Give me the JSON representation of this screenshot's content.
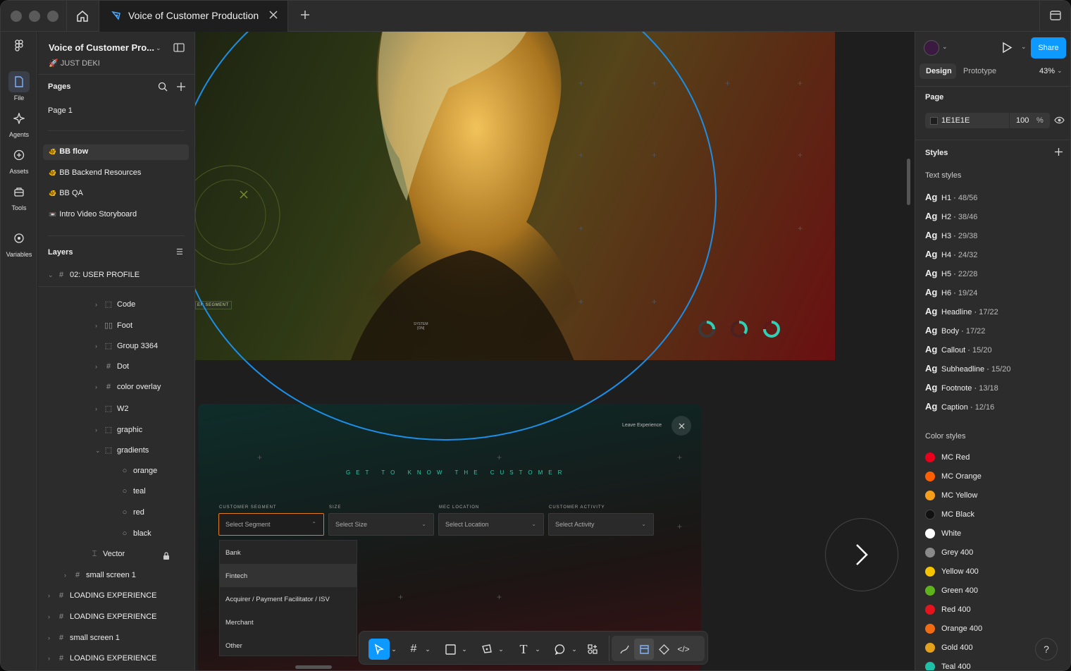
{
  "titlebar": {
    "tab_title": "Voice of Customer Production"
  },
  "rail": {
    "items": [
      {
        "label": "File",
        "icon": "file-icon"
      },
      {
        "label": "Agents",
        "icon": "agents-icon"
      },
      {
        "label": "Assets",
        "icon": "assets-icon"
      },
      {
        "label": "Tools",
        "icon": "tools-icon"
      },
      {
        "label": "Variables",
        "icon": "variables-icon"
      }
    ]
  },
  "left": {
    "file_name": "Voice of Customer Pro...",
    "team": "🚀 JUST DEKI",
    "pages_title": "Pages",
    "page1": "Page 1",
    "pages": [
      {
        "emoji": "🐠",
        "label": "BB flow"
      },
      {
        "emoji": "🐠",
        "label": "BB Backend Resources"
      },
      {
        "emoji": "🐠",
        "label": "BB QA"
      },
      {
        "emoji": "📼",
        "label": "Intro Video Storyboard"
      }
    ],
    "layers_title": "Layers",
    "layers": [
      {
        "label": "02: USER PROFILE",
        "icon": "#",
        "chev": "⌄"
      },
      {
        "label": "Code",
        "icon": "⬚",
        "chev": "›"
      },
      {
        "label": "Foot",
        "icon": "▯▯",
        "chev": "›"
      },
      {
        "label": "Group 3364",
        "icon": "⬚",
        "chev": "›"
      },
      {
        "label": "Dot",
        "icon": "#",
        "chev": "›"
      },
      {
        "label": "color overlay",
        "icon": "#",
        "chev": "›"
      },
      {
        "label": "W2",
        "icon": "⬚",
        "chev": "›"
      },
      {
        "label": "graphic",
        "icon": "⬚",
        "chev": "›"
      },
      {
        "label": "gradients",
        "icon": "⬚",
        "chev": "⌄"
      },
      {
        "label": "orange",
        "icon": "○",
        "chev": ""
      },
      {
        "label": "teal",
        "icon": "○",
        "chev": ""
      },
      {
        "label": "red",
        "icon": "○",
        "chev": ""
      },
      {
        "label": "black",
        "icon": "○",
        "chev": ""
      },
      {
        "label": "Vector",
        "icon": "⌶",
        "chev": ""
      },
      {
        "label": "small screen 1",
        "icon": "#",
        "chev": "›"
      },
      {
        "label": "LOADING EXPERIENCE",
        "icon": "#",
        "chev": "›"
      },
      {
        "label": "LOADING EXPERIENCE",
        "icon": "#",
        "chev": "›"
      },
      {
        "label": "small screen 1",
        "icon": "#",
        "chev": "›"
      },
      {
        "label": "LOADING EXPERIENCE",
        "icon": "#",
        "chev": "›"
      }
    ]
  },
  "canvas": {
    "frame_label_partial": "r",
    "segment_tag": "ER SEGMENT",
    "system_label": "SYSTEM",
    "system_value": "[ON]",
    "leave_experience": "Leave Experience",
    "heading": "GET TO KNOW THE CUSTOMER",
    "fields": [
      {
        "label": "CUSTOMER SEGMENT",
        "placeholder": "Select Segment"
      },
      {
        "label": "SIZE",
        "placeholder": "Select Size"
      },
      {
        "label": "MEC LOCATION",
        "placeholder": "Select Location"
      },
      {
        "label": "CUSTOMER ACTIVITY",
        "placeholder": "Select Activity"
      }
    ],
    "options": [
      "Bank",
      "Fintech",
      "Acquirer / Payment Facilitator / ISV",
      "Merchant",
      "Other"
    ]
  },
  "right": {
    "share": "Share",
    "tab_design": "Design",
    "tab_prototype": "Prototype",
    "zoom": "43%",
    "page_title": "Page",
    "page_color": "1E1E1E",
    "page_opacity": "100",
    "percent": "%",
    "styles_title": "Styles",
    "text_styles_title": "Text styles",
    "text_styles": [
      {
        "name": "H1",
        "size": "48/56"
      },
      {
        "name": "H2",
        "size": "38/46"
      },
      {
        "name": "H3",
        "size": "29/38"
      },
      {
        "name": "H4",
        "size": "24/32"
      },
      {
        "name": "H5",
        "size": "22/28"
      },
      {
        "name": "H6",
        "size": "19/24"
      },
      {
        "name": "Headline",
        "size": "17/22"
      },
      {
        "name": "Body",
        "size": "17/22"
      },
      {
        "name": "Callout",
        "size": "15/20"
      },
      {
        "name": "Subheadline",
        "size": "15/20"
      },
      {
        "name": "Footnote",
        "size": "13/18"
      },
      {
        "name": "Caption",
        "size": "12/16"
      }
    ],
    "color_styles_title": "Color styles",
    "color_styles": [
      {
        "name": "MC Red",
        "color": "#eb001b"
      },
      {
        "name": "MC Orange",
        "color": "#ff5f00"
      },
      {
        "name": "MC Yellow",
        "color": "#f79e1b"
      },
      {
        "name": "MC Black",
        "color": "#111111"
      },
      {
        "name": "White",
        "color": "#ffffff"
      },
      {
        "name": "Grey 400",
        "color": "#8a8a8a"
      },
      {
        "name": "Yellow 400",
        "color": "#f5c400"
      },
      {
        "name": "Green 400",
        "color": "#5fb31a"
      },
      {
        "name": "Red 400",
        "color": "#e5141c"
      },
      {
        "name": "Orange 400",
        "color": "#f06b12"
      },
      {
        "name": "Gold 400",
        "color": "#e3a11c"
      },
      {
        "name": "Teal 400",
        "color": "#1fbfa8"
      }
    ]
  }
}
